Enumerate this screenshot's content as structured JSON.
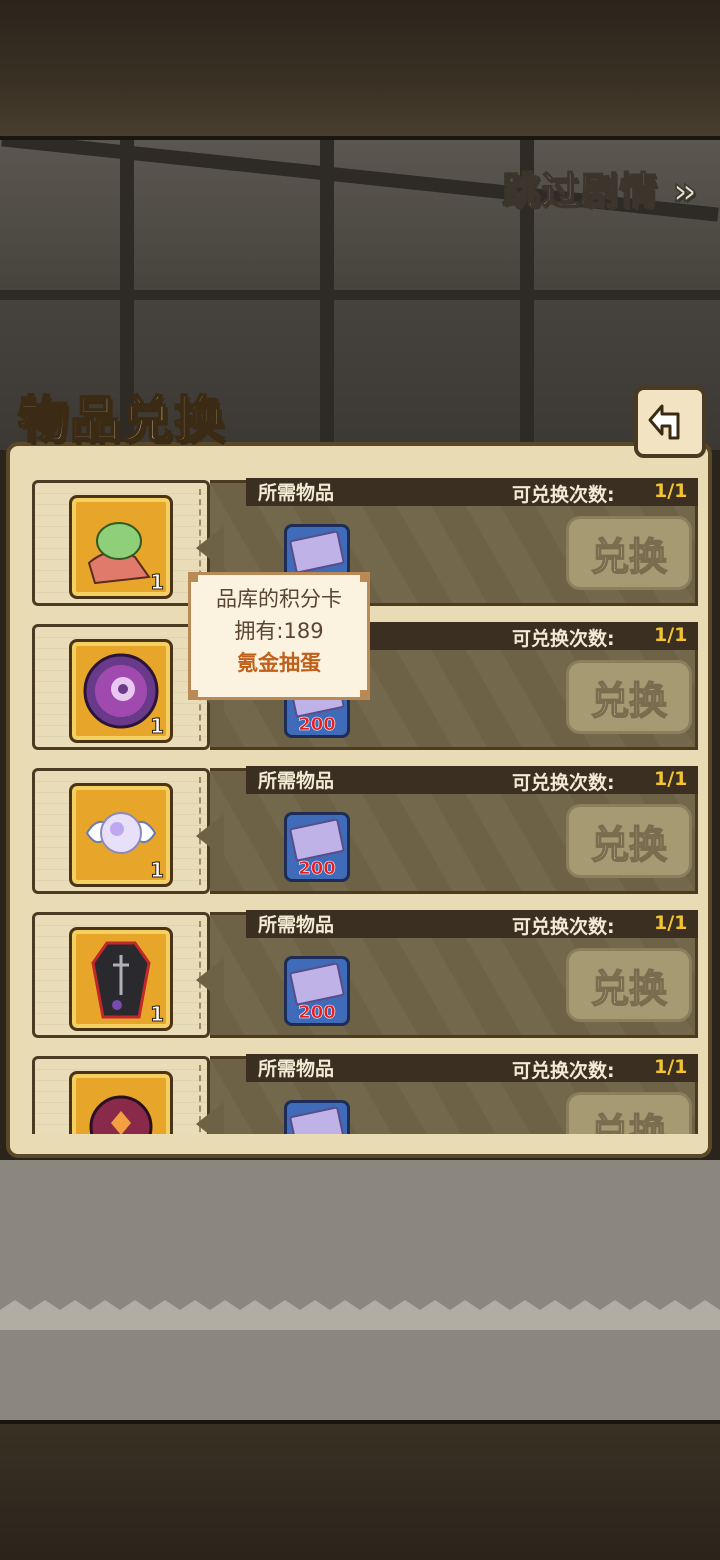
{
  "skip_label": "跳过剧情 »",
  "panel_title": "物品兑换",
  "back_icon": "back-arrow-icon",
  "rows": [
    {
      "item_icon": "green-egg-scarf-icon",
      "item_count": "1",
      "need_label": "所需物品",
      "count_label": "可兑换次数:",
      "count_value": "1/1",
      "cost": "200",
      "button": "兑换"
    },
    {
      "item_icon": "purple-orb-icon",
      "item_count": "1",
      "need_label": "",
      "count_label": "可兑换次数:",
      "count_value": "1/1",
      "cost": "200",
      "button": "兑换"
    },
    {
      "item_icon": "winged-pearl-icon",
      "item_count": "1",
      "need_label": "所需物品",
      "count_label": "可兑换次数:",
      "count_value": "1/1",
      "cost": "200",
      "button": "兑换"
    },
    {
      "item_icon": "coffin-icon",
      "item_count": "1",
      "need_label": "所需物品",
      "count_label": "可兑换次数:",
      "count_value": "1/1",
      "cost": "200",
      "button": "兑换"
    },
    {
      "item_icon": "demon-mask-icon",
      "item_count": "",
      "need_label": "所需物品",
      "count_label": "可兑换次数:",
      "count_value": "1/1",
      "cost": "",
      "button": "兑换"
    }
  ],
  "tooltip": {
    "name": "品库的积分卡",
    "owned": "拥有:189",
    "source": "氪金抽蛋"
  }
}
